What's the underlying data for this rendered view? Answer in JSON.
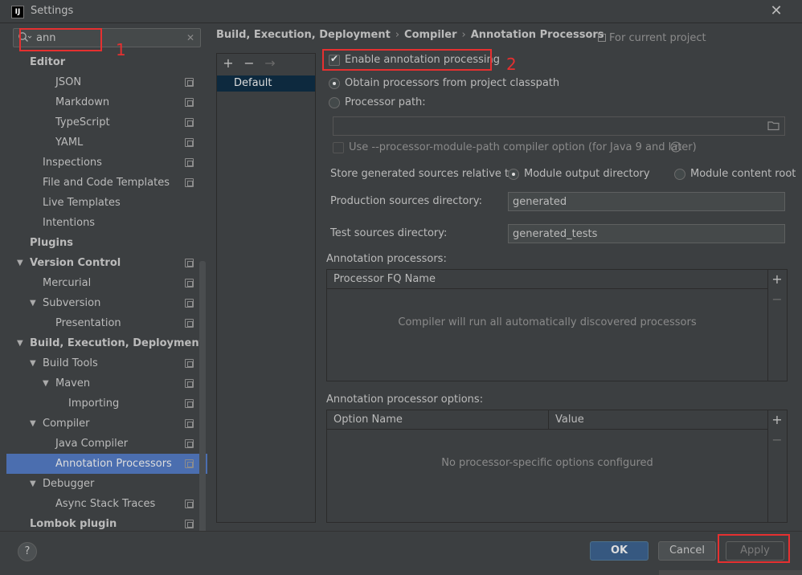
{
  "window": {
    "title": "Settings",
    "app_icon": "IJ"
  },
  "search": {
    "value": "ann"
  },
  "annotations": {
    "step1": "1",
    "step2": "2"
  },
  "tree": [
    {
      "label": "Editor",
      "bold": true,
      "arrow": "",
      "project": false
    },
    {
      "label": "JSON",
      "bold": false,
      "arrow": "",
      "project": true
    },
    {
      "label": "Markdown",
      "bold": false,
      "arrow": "",
      "project": true
    },
    {
      "label": "TypeScript",
      "bold": false,
      "arrow": "",
      "project": true
    },
    {
      "label": "YAML",
      "bold": false,
      "arrow": "",
      "project": true
    },
    {
      "label": "Inspections",
      "bold": false,
      "arrow": "",
      "project": true
    },
    {
      "label": "File and Code Templates",
      "bold": false,
      "arrow": "",
      "project": true
    },
    {
      "label": "Live Templates",
      "bold": false,
      "arrow": "",
      "project": false
    },
    {
      "label": "Intentions",
      "bold": false,
      "arrow": "",
      "project": false
    },
    {
      "label": "Plugins",
      "bold": true,
      "arrow": "",
      "project": false
    },
    {
      "label": "Version Control",
      "bold": true,
      "arrow": "▼",
      "project": true
    },
    {
      "label": "Mercurial",
      "bold": false,
      "arrow": "",
      "project": true
    },
    {
      "label": "Subversion",
      "bold": false,
      "arrow": "▼",
      "project": true
    },
    {
      "label": "Presentation",
      "bold": false,
      "arrow": "",
      "project": true
    },
    {
      "label": "Build, Execution, Deployment",
      "bold": true,
      "arrow": "▼",
      "project": false
    },
    {
      "label": "Build Tools",
      "bold": false,
      "arrow": "▼",
      "project": true
    },
    {
      "label": "Maven",
      "bold": false,
      "arrow": "▼",
      "project": true
    },
    {
      "label": "Importing",
      "bold": false,
      "arrow": "",
      "project": true
    },
    {
      "label": "Compiler",
      "bold": false,
      "arrow": "▼",
      "project": true
    },
    {
      "label": "Java Compiler",
      "bold": false,
      "arrow": "",
      "project": true
    },
    {
      "label": "Annotation Processors",
      "bold": false,
      "arrow": "",
      "project": true,
      "selected": true
    },
    {
      "label": "Debugger",
      "bold": false,
      "arrow": "▼",
      "project": false
    },
    {
      "label": "Async Stack Traces",
      "bold": false,
      "arrow": "",
      "project": true
    },
    {
      "label": "Lombok plugin",
      "bold": true,
      "arrow": "",
      "project": true
    }
  ],
  "breadcrumb": {
    "part1": "Build, Execution, Deployment",
    "part2": "Compiler",
    "part3": "Annotation Processors",
    "sep": "›"
  },
  "for_project": "For current project",
  "profiles": {
    "add": "+",
    "remove": "−",
    "move": "→",
    "default": "Default"
  },
  "settings": {
    "enable_label": "Enable annotation processing",
    "obtain_label": "Obtain processors from project classpath",
    "processor_path_label": "Processor path:",
    "module_path_label": "Use --processor-module-path compiler option (for Java 9 and later)",
    "store_label": "Store generated sources relative to:",
    "module_output_label": "Module output directory",
    "module_content_label": "Module content root",
    "prod_dir_label": "Production sources directory:",
    "prod_dir_value": "generated",
    "test_dir_label": "Test sources directory:",
    "test_dir_value": "generated_tests"
  },
  "processors_table": {
    "title": "Annotation processors:",
    "col": "Processor FQ Name",
    "empty": "Compiler will run all automatically discovered processors",
    "add": "+",
    "remove": "−"
  },
  "options_table": {
    "title": "Annotation processor options:",
    "col1": "Option Name",
    "col2": "Value",
    "empty": "No processor-specific options configured",
    "add": "+",
    "remove": "−"
  },
  "footer": {
    "help": "?",
    "ok": "OK",
    "cancel": "Cancel",
    "apply": "Apply"
  },
  "colors": {
    "accent_selection": "#4b6eaf",
    "highlight_red": "#e53030",
    "ok_button": "#365880"
  }
}
